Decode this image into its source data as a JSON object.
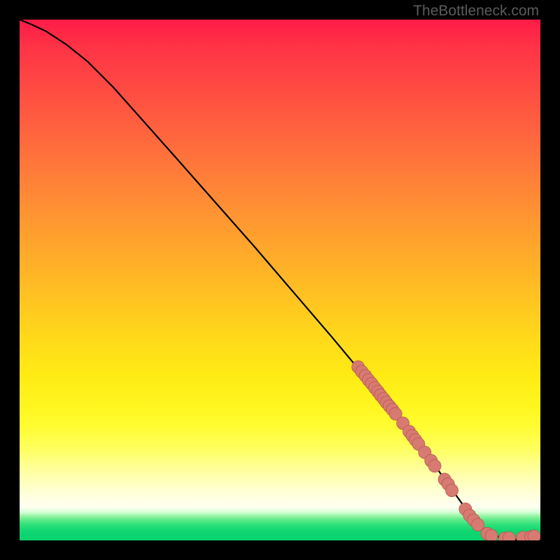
{
  "watermark": "TheBottleneck.com",
  "colors": {
    "frame": "#000000",
    "dot_fill": "#d77a71",
    "dot_stroke": "#b9574f",
    "line": "#000000"
  },
  "chart_data": {
    "type": "line",
    "title": "",
    "xlabel": "",
    "ylabel": "",
    "xlim": [
      0,
      100
    ],
    "ylim": [
      0,
      100
    ],
    "curve": {
      "x": [
        0,
        2,
        5,
        9,
        13,
        18,
        30,
        45,
        60,
        70,
        80,
        85,
        88,
        90,
        92,
        94,
        96,
        98,
        100
      ],
      "y": [
        100,
        99.2,
        97.8,
        95.2,
        92.0,
        87.0,
        73.5,
        56.5,
        39.0,
        27.0,
        14.0,
        7.0,
        3.2,
        1.5,
        0.7,
        0.25,
        0.1,
        0.05,
        0.0
      ]
    },
    "points": [
      {
        "x": 65.0,
        "y": 33.3
      },
      {
        "x": 65.7,
        "y": 32.4
      },
      {
        "x": 66.4,
        "y": 31.6
      },
      {
        "x": 67.0,
        "y": 30.8
      },
      {
        "x": 67.6,
        "y": 30.1
      },
      {
        "x": 68.2,
        "y": 29.3
      },
      {
        "x": 68.8,
        "y": 28.6
      },
      {
        "x": 69.3,
        "y": 27.9
      },
      {
        "x": 69.9,
        "y": 27.2
      },
      {
        "x": 70.4,
        "y": 26.5
      },
      {
        "x": 71.0,
        "y": 25.8
      },
      {
        "x": 71.6,
        "y": 25.1
      },
      {
        "x": 72.2,
        "y": 24.3
      },
      {
        "x": 73.6,
        "y": 22.5
      },
      {
        "x": 74.8,
        "y": 20.9
      },
      {
        "x": 75.4,
        "y": 20.1
      },
      {
        "x": 76.0,
        "y": 19.3
      },
      {
        "x": 76.6,
        "y": 18.5
      },
      {
        "x": 77.8,
        "y": 16.9
      },
      {
        "x": 79.0,
        "y": 15.3
      },
      {
        "x": 79.7,
        "y": 14.3
      },
      {
        "x": 81.6,
        "y": 11.7
      },
      {
        "x": 82.3,
        "y": 10.8
      },
      {
        "x": 83.0,
        "y": 9.6
      },
      {
        "x": 85.6,
        "y": 6.0
      },
      {
        "x": 86.4,
        "y": 4.8
      },
      {
        "x": 87.2,
        "y": 3.9
      },
      {
        "x": 88.0,
        "y": 3.0
      },
      {
        "x": 89.8,
        "y": 1.3
      },
      {
        "x": 90.6,
        "y": 0.9
      },
      {
        "x": 93.2,
        "y": 0.4
      },
      {
        "x": 94.0,
        "y": 0.45
      },
      {
        "x": 96.6,
        "y": 0.55
      },
      {
        "x": 98.2,
        "y": 0.7
      },
      {
        "x": 98.8,
        "y": 0.8
      }
    ]
  }
}
